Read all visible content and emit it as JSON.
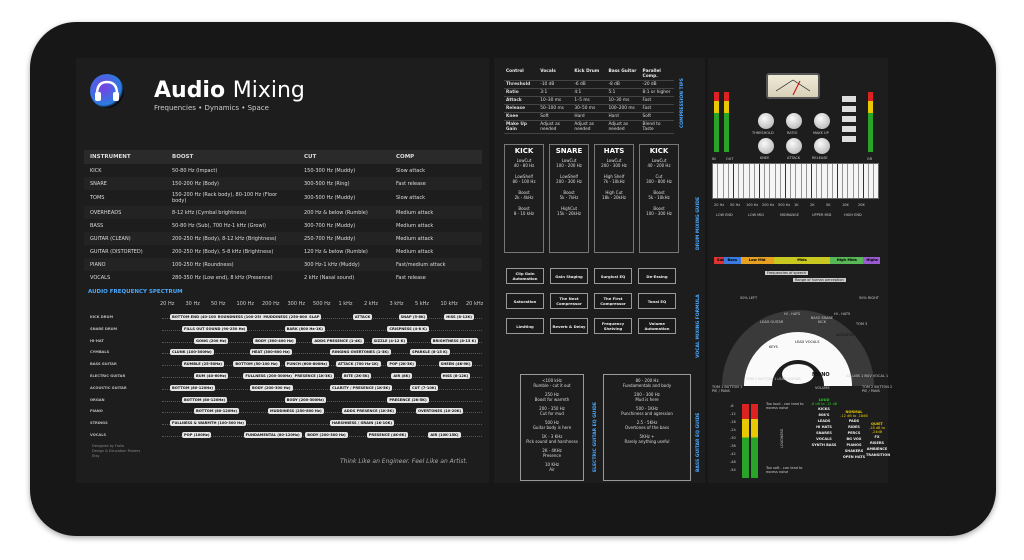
{
  "header": {
    "title_bold": "Audio",
    "title_rest": "Mixing",
    "subtitle": "Frequencies • Dynamics • Space"
  },
  "instruments": {
    "headers": [
      "INSTRUMENT",
      "BOOST",
      "CUT",
      "COMP"
    ],
    "rows": [
      [
        "KICK",
        "50-80 Hz (Impact)",
        "150-300 Hz (Muddy)",
        "Slow attack"
      ],
      [
        "SNARE",
        "150-200 Hz (Body)",
        "300-500 Hz (Ring)",
        "Fast release"
      ],
      [
        "TOMS",
        "150-200 Hz (Rack body), 80-100 Hz (Floor body)",
        "300-500 Hz (Muddy)",
        "Slow attack"
      ],
      [
        "OVERHEADS",
        "8-12 kHz (Cymbal brightness)",
        "200 Hz & below (Rumble)",
        "Medium attack"
      ],
      [
        "BASS",
        "50-80 Hz (Sub), 700 Hz-1 kHz (Growl)",
        "300-700 Hz (Muddy)",
        "Medium attack"
      ],
      [
        "GUITAR (CLEAN)",
        "200-250 Hz (Body), 8-12 kHz (Brightness)",
        "250-700 Hz (Muddy)",
        "Medium attack"
      ],
      [
        "GUITAR (DISTORTED)",
        "200-250 Hz (Body), 5-8 kHz (Brightness)",
        "120 Hz & below (Rumble)",
        "Medium attack"
      ],
      [
        "PIANO",
        "100-250 Hz (Roundness)",
        "300 Hz-1 kHz (Muddy)",
        "Fast/medium attack"
      ],
      [
        "VOCALS",
        "280-350 Hz (Low end), 8 kHz (Presence)",
        "2 kHz (Nasal sound)",
        "Fast release"
      ]
    ]
  },
  "spectrum": {
    "title": "AUDIO FREQUENCY SPECTRUM",
    "freqs": [
      "20 Hz",
      "30 Hz",
      "50 Hz",
      "100 Hz",
      "200 Hz",
      "300 Hz",
      "500 Hz",
      "1 kHz",
      "2 kHz",
      "3 kHz",
      "5 kHz",
      "10 kHz",
      "20 kHz"
    ],
    "rows": [
      {
        "label": "KICK DRUM",
        "tags": [
          "BOTTOM END (40-100 Hz)",
          "ROUNDNESS (100-250 Hz)",
          "MUDDINESS (250-800 Hz)",
          "SLAP",
          "ATTACK",
          "SNAP (5-8K)",
          "HISS (8-12K)"
        ]
      },
      {
        "label": "SNARE DRUM",
        "tags": [
          "FILLS OUT SOUND (90-250 Hz)",
          "BARK (800 Hz-1K)",
          "CRISPNESS (4-8 K)"
        ]
      },
      {
        "label": "HI-HAT",
        "tags": [
          "GONG (200 Hz)",
          "BODY (300-400 Hz)",
          "ADDS PRESENCE (1-4K)",
          "SIZZLE (4-12 K)",
          "BRIGHTNESS (8-15 K)"
        ]
      },
      {
        "label": "CYMBALS",
        "tags": [
          "CLUNK (100-300Hz)",
          "HEAT (300-600 Hz)",
          "RINGING OVERTONES (1-3K)",
          "SPARKLE (8-15 K)"
        ]
      },
      {
        "label": "BASS GUITAR",
        "tags": [
          "RUMBLE (25-50Hz)",
          "BOTTOM (50-100 Hz)",
          "PUNCH (600-800Hz)",
          "ATTACK (700 Hz-1K)",
          "POP (2K-3K)",
          "SHEEN (4K-9K)"
        ]
      },
      {
        "label": "ELECTRIC GUITAR",
        "tags": [
          "BUM (40-60Hz)",
          "FULLNESS (200-300Hz)",
          "PRESENCE (1K-3K)",
          "BITE (2K-5K)",
          "AIR (8K)",
          "HISS (8-12K)"
        ]
      },
      {
        "label": "ACOUSTIC GUITAR",
        "tags": [
          "BOTTOM (80-120Hz)",
          "BODY (200-300 Hz)",
          "CLARITY / PRESENCE (1K-5K)",
          "CUT (7-10K)"
        ]
      },
      {
        "label": "ORGAN",
        "tags": [
          "BOTTOM (80-120Hz)",
          "BODY (200-300Hz)",
          "PRESENCE (2K-5K)"
        ]
      },
      {
        "label": "PIANO",
        "tags": [
          "BOTTOM (80-120Hz)",
          "MUDDINESS (250-800 Hz)",
          "ADDS PRESENCE (1K-5K)",
          "OVERTONES (10-20K)"
        ]
      },
      {
        "label": "STRINGS",
        "tags": [
          "FULLNESS & WARMTH (100-300 Hz)",
          "HARSHNESS / GRAIN (1K-10K)"
        ]
      },
      {
        "label": "VOCALS",
        "tags": [
          "POP (100Hz)",
          "FUNDAMENTAL (80-120Hz)",
          "BODY (200-300 Hz)",
          "PRESENCE (4K-6K)",
          "AIR (10K-15K)"
        ]
      }
    ]
  },
  "footer": {
    "credit_1": "Designed by Frollo",
    "credit_2": "Design & Education Posters",
    "credit_3": "Etsy",
    "tagline": "Think Like an Engineer. Feel Like an Artist."
  },
  "compression": {
    "title": "COMPRESSION TIPS",
    "headers": [
      "Control",
      "Vocals",
      "Kick Drum",
      "Bass Guitar",
      "Parallel Comp."
    ],
    "rows": [
      [
        "Threshold",
        "-10 dB",
        "-6 dB",
        "-8 dB",
        "-20 dB"
      ],
      [
        "Ratio",
        "3:1",
        "4:1",
        "5:1",
        "8:1 or higher"
      ],
      [
        "Attack",
        "10–30 ms",
        "1–5 ms",
        "10–30 ms",
        "Fast"
      ],
      [
        "Release",
        "50–100 ms",
        "30–50 ms",
        "100–200 ms",
        "Fast"
      ],
      [
        "Knee",
        "Soft",
        "Hard",
        "Hard",
        "Soft"
      ],
      [
        "Make Up Gain",
        "Adjust as needed",
        "Adjust as needed",
        "Adjust as needed",
        "Blend to Taste"
      ]
    ]
  },
  "drum_eq": {
    "title": "DRUM MIXING GUIDE",
    "cols": [
      {
        "name": "KICK",
        "lines": [
          "LowCut",
          "40 - 80 Hz",
          "LowShelf",
          "80 - 100 Hz",
          "Boost",
          "2k - 4kHz",
          "Boost",
          "8 - 10 kHz"
        ]
      },
      {
        "name": "SNARE",
        "lines": [
          "LowCut",
          "100 - 200 Hz",
          "LowShelf",
          "200 - 300 Hz",
          "Boost",
          "5k - 7kHz",
          "HighCut",
          "15k - 20kHz"
        ]
      },
      {
        "name": "HATS",
        "lines": [
          "LowCut",
          "200 - 300 Hz",
          "High Shelf",
          "7k - 10kHz",
          "High Cut",
          "18k - 20kHz"
        ]
      },
      {
        "name": "KICK",
        "lines": [
          "LowCut",
          "40 - 200 Hz",
          "Cut",
          "300 - 800 Hz",
          "Boost",
          "5k - 10kHz",
          "Boost",
          "100 - 300 Hz"
        ]
      }
    ]
  },
  "vocal_chain": {
    "title": "VOCAL MIXING FORMULA",
    "steps": [
      "Clip Gain Automation",
      "Gain Staging",
      "Surgical EQ",
      "De-Essing",
      "Saturation",
      "The Next Compressor",
      "The First Compressor",
      "Tonal EQ",
      "Limiting",
      "Reverb & Delay",
      "Frequency Shelving",
      "Volume Automation"
    ]
  },
  "electric_eq": {
    "title": "ELECTRIC GUITAR EQ GUIDE",
    "items": [
      "<100 kHz\nRumble - cut it out",
      "250 Hz\nBoost for warmth",
      "200 - 350 Hz\nCut for mud",
      "500 Hz\nGuitar body is here",
      "1K - 3 KHz\nPick sound and harshness",
      "2K - 4KHz\nPresence",
      "10 KHz\nAir"
    ]
  },
  "bass_eq": {
    "title": "BASS GUITAR EQ GUIDE",
    "items": [
      "80 - 200 Hz\nFundamentals and body",
      "200 - 300 Hz\nMud is here",
      "500 - 1KHz\nPunchiness and agression",
      "2.5 - 5KHz\nOvertones of the bass",
      "5KHz +\nRarely anything useful"
    ]
  },
  "console": {
    "meter_labels": [
      "IN",
      "OUT",
      "GR"
    ],
    "knobs_top": [
      "THRESHOLD",
      "RATIO",
      "MAKE UP"
    ],
    "knobs_bottom": [
      "KNEE",
      "ATTACK",
      "RELEASE"
    ],
    "keyboard_freqs": [
      "20 Hz",
      "50 Hz",
      "100 Hz",
      "200 Hz",
      "500 Hz",
      "1K",
      "2K",
      "5K",
      "10K",
      "20K"
    ],
    "ranges": [
      "LOW END",
      "LOW MID",
      "MIDRANGE",
      "UPPER MID",
      "HIGH END"
    ],
    "bands": [
      "Sub",
      "Bass",
      "Low Mid",
      "Mids",
      "High Mids",
      "Highs"
    ],
    "band_colors": [
      "#d33",
      "#3a7ae0",
      "#e8a020",
      "#c8c820",
      "#58b858",
      "#9a5ad0"
    ],
    "band_notes": [
      "Frequencies of speech",
      "Range of human perception"
    ]
  },
  "stage": {
    "positions": [
      "LEAD GUITAR",
      "BASS SNARE KICK",
      "TOM 3",
      "LEAD VOCALS",
      "KEYS",
      "ACOUSTIC",
      "TOM 1 BUTTON 1 LEAD GUITAR",
      "AD-LIBS 1 BGV VOCAL 1"
    ],
    "far_labels": [
      "50% LEFT",
      "50% RIGHT"
    ],
    "inner_labels": [
      "HI - HATS",
      "HI - HATS"
    ],
    "mono_label": "MONO",
    "lr_labels": [
      "TOM 1 BUTTON 1\nPIE / PANS",
      "TOM 2 BUTTON 2\nPIE / PANS"
    ],
    "volume_labels": [
      "VOLUME",
      "VOLUME",
      "VOLUME"
    ]
  },
  "levels": {
    "scale": [
      "-6",
      "-12",
      "-18",
      "-24",
      "-30",
      "-36",
      "-42",
      "-48",
      "-54"
    ],
    "note_top": "Too loud - can lead to excess noise",
    "note_bottom": "Too soft - can lead to excess noise",
    "loudness": "LOUDNESS",
    "loud": {
      "title": "LOUD",
      "range": "-6 dB to -12 dB",
      "items": [
        "KICKS",
        "808'S",
        "LEADS",
        "HI HATS",
        "SNARES",
        "VOCALS",
        "SYNTH BASS"
      ]
    },
    "normal": {
      "title": "NORMAL",
      "range": "-12 dB to -18dB",
      "items": [
        "PADS",
        "RIDES",
        "PERCS",
        "BG VOX",
        "PIANOS",
        "SHAKERS",
        "OPEN HATS"
      ]
    },
    "quiet": {
      "title": "QUIET",
      "range": "-18 dB to -24dB",
      "items": [
        "FX",
        "RISERS",
        "AMBIENCE",
        "TRANSITION"
      ]
    }
  }
}
